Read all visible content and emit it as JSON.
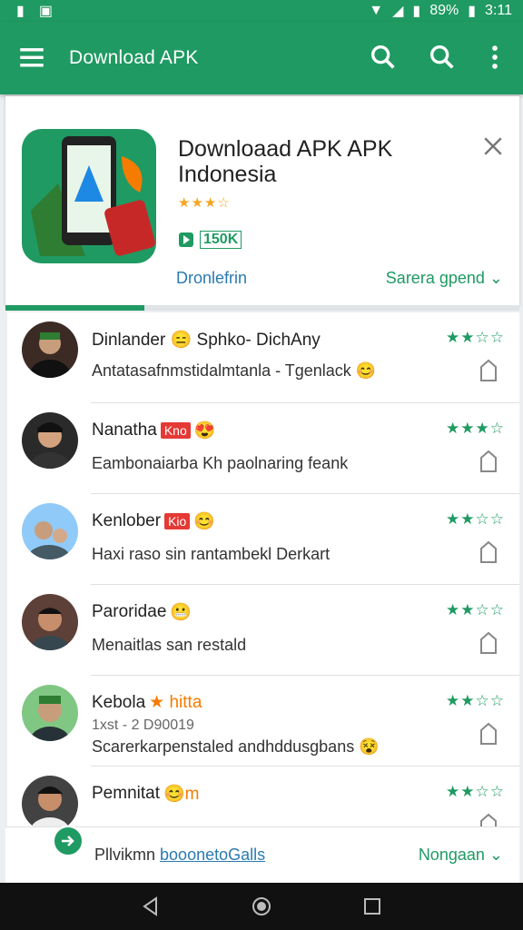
{
  "status": {
    "left_icons": [
      "sim-icon",
      "screen-icon"
    ],
    "battery": "89%",
    "time": "3:11"
  },
  "appbar": {
    "title": "Download APK",
    "icons": [
      "menu-icon",
      "search-icon",
      "search-icon",
      "more-vert-icon"
    ]
  },
  "colors": {
    "primary": "#1f9a62",
    "link": "#2a7ab0",
    "star": "#f5a623",
    "badge": "#e53935"
  },
  "app_card": {
    "title": "Downloaad APK APK Indonesia",
    "rating_stars": "★★★☆",
    "download_count": "150K",
    "link_left": "Dronlefrin",
    "link_right": "Sarera gpend",
    "progress": 0.27
  },
  "reviews": [
    {
      "name": "Dinlander 😑 Sphko- DichAny",
      "badge": "",
      "sub": "Antatasafnmstidalmtanla - Tgenlack 😊",
      "meta": "",
      "stars": "★★☆☆"
    },
    {
      "name": "Nanatha",
      "badge": "Kno",
      "emoji": "😍",
      "sub": "Eambonaiarba Kh paolnaring feank",
      "meta": "",
      "stars": "★★★☆"
    },
    {
      "name": "Kenlober",
      "badge": "Kio",
      "emoji": "😊",
      "sub": "Haxi raso sin rantambekl Derkart",
      "meta": "",
      "stars": "★★☆☆"
    },
    {
      "name": "Paroridae",
      "badge": "",
      "emoji": "😬",
      "sub": "Menaitlas san restald",
      "meta": "",
      "stars": "★★☆☆"
    },
    {
      "name": "Kebola",
      "badge": "",
      "emoji": "★ hitta",
      "sub": "Scarerkarpenstaled andhddusgbans 😵",
      "meta": "1xst - 2 D90019",
      "stars": "★★☆☆"
    },
    {
      "name": "Pemnitat",
      "badge": "",
      "emoji": "😊m",
      "sub": "",
      "meta": "",
      "stars": "★★☆☆"
    }
  ],
  "footer": {
    "left_label": "Pllvikmn",
    "left_link": "booonetoGalls",
    "right_label": "Nongaan"
  }
}
